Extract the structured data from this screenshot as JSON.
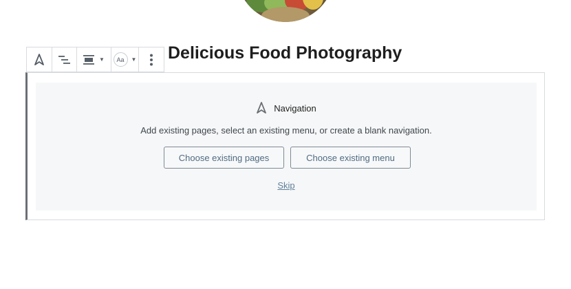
{
  "site": {
    "title": "Delicious Food Photography"
  },
  "toolbar": {
    "items": [
      {
        "name": "navigation-block-icon"
      },
      {
        "name": "list-view-icon"
      },
      {
        "name": "justify-center-icon"
      },
      {
        "name": "text-size-icon",
        "glyph": "Aa"
      },
      {
        "name": "more-options-icon"
      }
    ]
  },
  "placeholder": {
    "label": "Navigation",
    "description": "Add existing pages, select an existing menu, or create a blank navigation.",
    "buttons": {
      "pages": "Choose existing pages",
      "menu": "Choose existing menu"
    },
    "skip": "Skip"
  },
  "colors": {
    "block_border": "#d7dade",
    "block_left_border": "#6b6f74",
    "placeholder_bg": "#f6f7f8",
    "button_text": "#4f6b82",
    "link": "#5f7f9a"
  }
}
